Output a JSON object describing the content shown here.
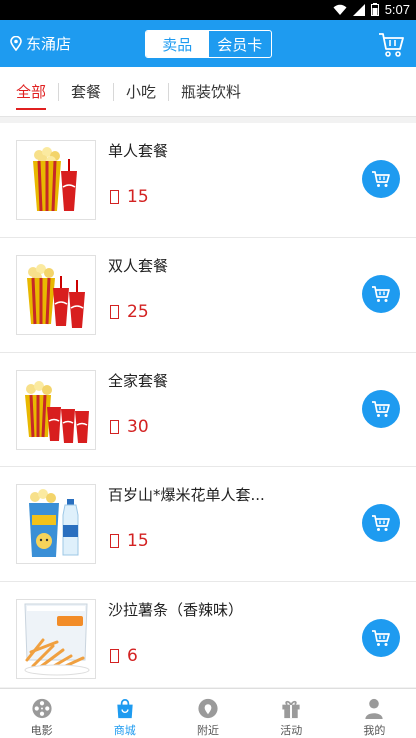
{
  "status_bar": {
    "time": "5:07"
  },
  "header": {
    "store_name": "东涌店",
    "segments": [
      {
        "label": "卖品",
        "active": true
      },
      {
        "label": "会员卡",
        "active": false
      }
    ]
  },
  "tabs": [
    {
      "label": "全部",
      "active": true
    },
    {
      "label": "套餐",
      "active": false
    },
    {
      "label": "小吃",
      "active": false
    },
    {
      "label": "瓶装饮料",
      "active": false
    }
  ],
  "products": [
    {
      "name": "单人套餐",
      "price": "15",
      "image": "popcorn-single-combo"
    },
    {
      "name": "双人套餐",
      "price": "25",
      "image": "popcorn-double-combo"
    },
    {
      "name": "全家套餐",
      "price": "30",
      "image": "popcorn-family-combo"
    },
    {
      "name": "百岁山*爆米花单人套...",
      "price": "15",
      "image": "popcorn-water-combo"
    },
    {
      "name": "沙拉薯条（香辣味）",
      "price": "6",
      "image": "fries-snack-bag"
    }
  ],
  "bottom_nav": [
    {
      "label": "电影",
      "icon": "film-reel-icon",
      "active": false
    },
    {
      "label": "商城",
      "icon": "shopping-bag-icon",
      "active": true
    },
    {
      "label": "附近",
      "icon": "location-icon",
      "active": false
    },
    {
      "label": "活动",
      "icon": "gift-icon",
      "active": false
    },
    {
      "label": "我的",
      "icon": "person-icon",
      "active": false
    }
  ],
  "colors": {
    "primary": "#1e9bf0",
    "price": "#d32222",
    "active_tab": "#e02020"
  }
}
